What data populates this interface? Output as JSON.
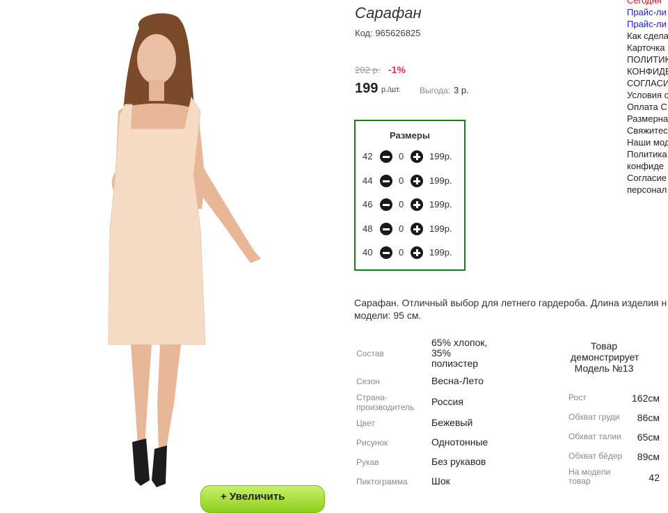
{
  "product": {
    "title": "Сарафан",
    "code": "Код: 965626825",
    "old_price": "202 р.",
    "discount": "-1%",
    "price": "199",
    "price_unit": "р./шт.",
    "benefit_label": "Выгода:",
    "benefit_value": "3 р."
  },
  "sizes": {
    "title": "Размеры",
    "rows": [
      {
        "size": "42",
        "qty": "0",
        "price": "199р."
      },
      {
        "size": "44",
        "qty": "0",
        "price": "199р."
      },
      {
        "size": "46",
        "qty": "0",
        "price": "199р."
      },
      {
        "size": "48",
        "qty": "0",
        "price": "199р."
      },
      {
        "size": "40",
        "qty": "0",
        "price": "199р."
      }
    ]
  },
  "description": {
    "line1": "Сарафан. Отличный выбор для летнего гардероба. Длина изделия н",
    "line2": "модели: 95 см."
  },
  "properties": [
    {
      "label": "Состав",
      "value": "65% хлопок, 35% полиэстер"
    },
    {
      "label": "Сезон",
      "value": "Весна-Лето"
    },
    {
      "label": "Страна-производитель",
      "value": "Россия"
    },
    {
      "label": "Цвет",
      "value": "Бежевый"
    },
    {
      "label": "Рисунок",
      "value": "Однотонные"
    },
    {
      "label": "Рукав",
      "value": "Без рукавов"
    },
    {
      "label": "Пиктограмма",
      "value": "Шок"
    }
  ],
  "model": {
    "title": "Товар демонстрирует Модель №13",
    "params": [
      {
        "label": "Рост",
        "value": "162см"
      },
      {
        "label": "Обхват груди",
        "value": "86см"
      },
      {
        "label": "Обхват талии",
        "value": "65см"
      },
      {
        "label": "Обхват бёдер",
        "value": "89см"
      },
      {
        "label": "На модели товар",
        "value": "42"
      }
    ]
  },
  "zoom_button": {
    "label": "+ Увеличить"
  },
  "right_links": [
    "Сегодня",
    "Прайс-ли",
    "Прайс-ли",
    "Как сдела",
    "Карточка",
    "ПОЛИТИК",
    "КОНФИДЕ",
    "СОГЛАСИ",
    "Условия о",
    "Оплата С",
    "Размерна",
    "Свяжитес",
    "Наши мод",
    "Политика",
    "конфиде",
    "Согласие",
    "персонал"
  ],
  "colors": {
    "discount": "#e53050",
    "sizes_border": "#1c7a1c",
    "dress": "#f7dcc5",
    "zoom_button": "#9bd82a"
  }
}
